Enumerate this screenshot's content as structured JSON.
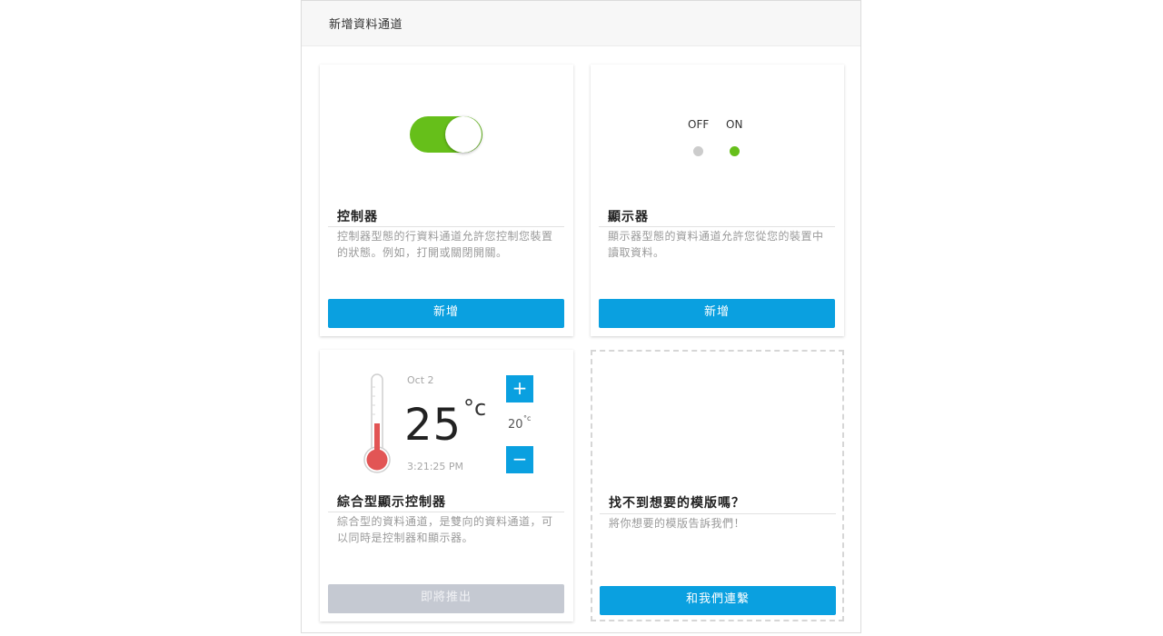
{
  "panel": {
    "title": "新增資料通道"
  },
  "cards": {
    "controller": {
      "title": "控制器",
      "description": "控制器型態的行資料通道允許您控制您裝置的狀態。例如，打開或關閉開關。",
      "button_label": "新增",
      "toggle_state": "on"
    },
    "display": {
      "title": "顯示器",
      "description": "顯示器型態的資料通道允許您從您的裝置中讀取資料。",
      "button_label": "新增",
      "off_label": "OFF",
      "on_label": "ON"
    },
    "combined": {
      "title": "綜合型顯示控制器",
      "description": "綜合型的資料通道，是雙向的資料通道，可以同時是控制器和顯示器。",
      "button_label": "即將推出",
      "date": "Oct 2",
      "temperature": "25",
      "unit": "°c",
      "set_temperature": "20",
      "set_unit": "°c",
      "time": "3:21:25 PM",
      "plus_symbol": "+",
      "minus_symbol": "−"
    },
    "template": {
      "title": "找不到想要的模版嗎？",
      "description": "將你想要的模版告訴我們！",
      "button_label": "和我們連繫"
    }
  },
  "colors": {
    "accent": "#0aa0e0",
    "toggle_on": "#66bf1a",
    "dot_off": "#cccccc",
    "dot_on": "#66bf1a",
    "thermometer_fill": "#e25555",
    "disabled_button": "#c5c9d2"
  }
}
